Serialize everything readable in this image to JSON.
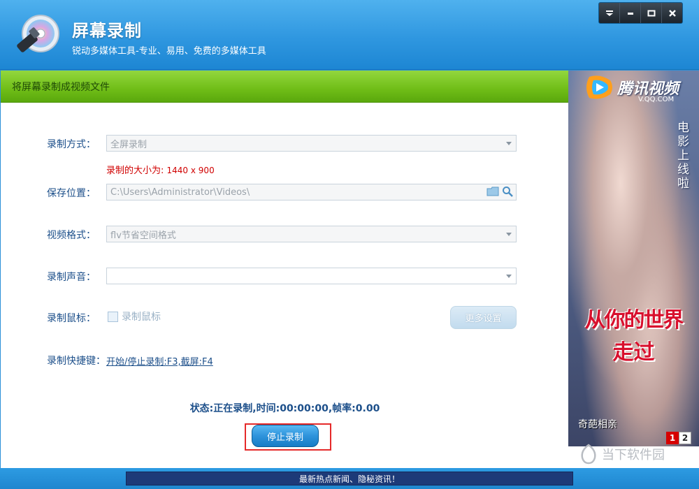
{
  "app": {
    "title": "屏幕录制",
    "subtitle": "锐动多媒体工具-专业、易用、免费的多媒体工具"
  },
  "window_controls": [
    "menu-icon",
    "minimize-icon",
    "maximize-icon",
    "close-icon"
  ],
  "section": {
    "title": "将屏幕录制成视频文件"
  },
  "form": {
    "record_mode": {
      "label": "录制方式：",
      "value": "全屏录制"
    },
    "size_note": {
      "prefix": "录制的大小为:",
      "value": "1440 x 900"
    },
    "save_location": {
      "label": "保存位置：",
      "value": "C:\\Users\\Administrator\\Videos\\"
    },
    "video_format": {
      "label": "视频格式：",
      "value": "flv节省空间格式"
    },
    "audio": {
      "label": "录制声音：",
      "value": ""
    },
    "mouse": {
      "label": "录制鼠标：",
      "checkbox_label": "录制鼠标"
    },
    "more_button": "更多设置",
    "hotkeys": {
      "label": "录制快捷键：",
      "value": "开始/停止录制:F3,截屏:F4"
    }
  },
  "status": {
    "text": "状态:正在录制,时间:00:00:00,帧率:0.00"
  },
  "stop_button": "停止录制",
  "ad": {
    "brand": "腾讯视频",
    "brand_sub": "V.QQ.COM",
    "vertical_text": "电影上线啦",
    "headline1": "从你的世界",
    "headline2": "走过",
    "bottom_label": "奇葩相亲",
    "pages": [
      "1",
      "2"
    ],
    "watermark": "当下软件园"
  },
  "footer": {
    "news": "最新热点新闻、隐秘资讯！"
  },
  "colors": {
    "header_blue": "#2f97e0",
    "section_green": "#6fbd17",
    "label_blue": "#1c4f8a",
    "size_red": "#d00000",
    "highlight_red": "#e52a2a"
  }
}
